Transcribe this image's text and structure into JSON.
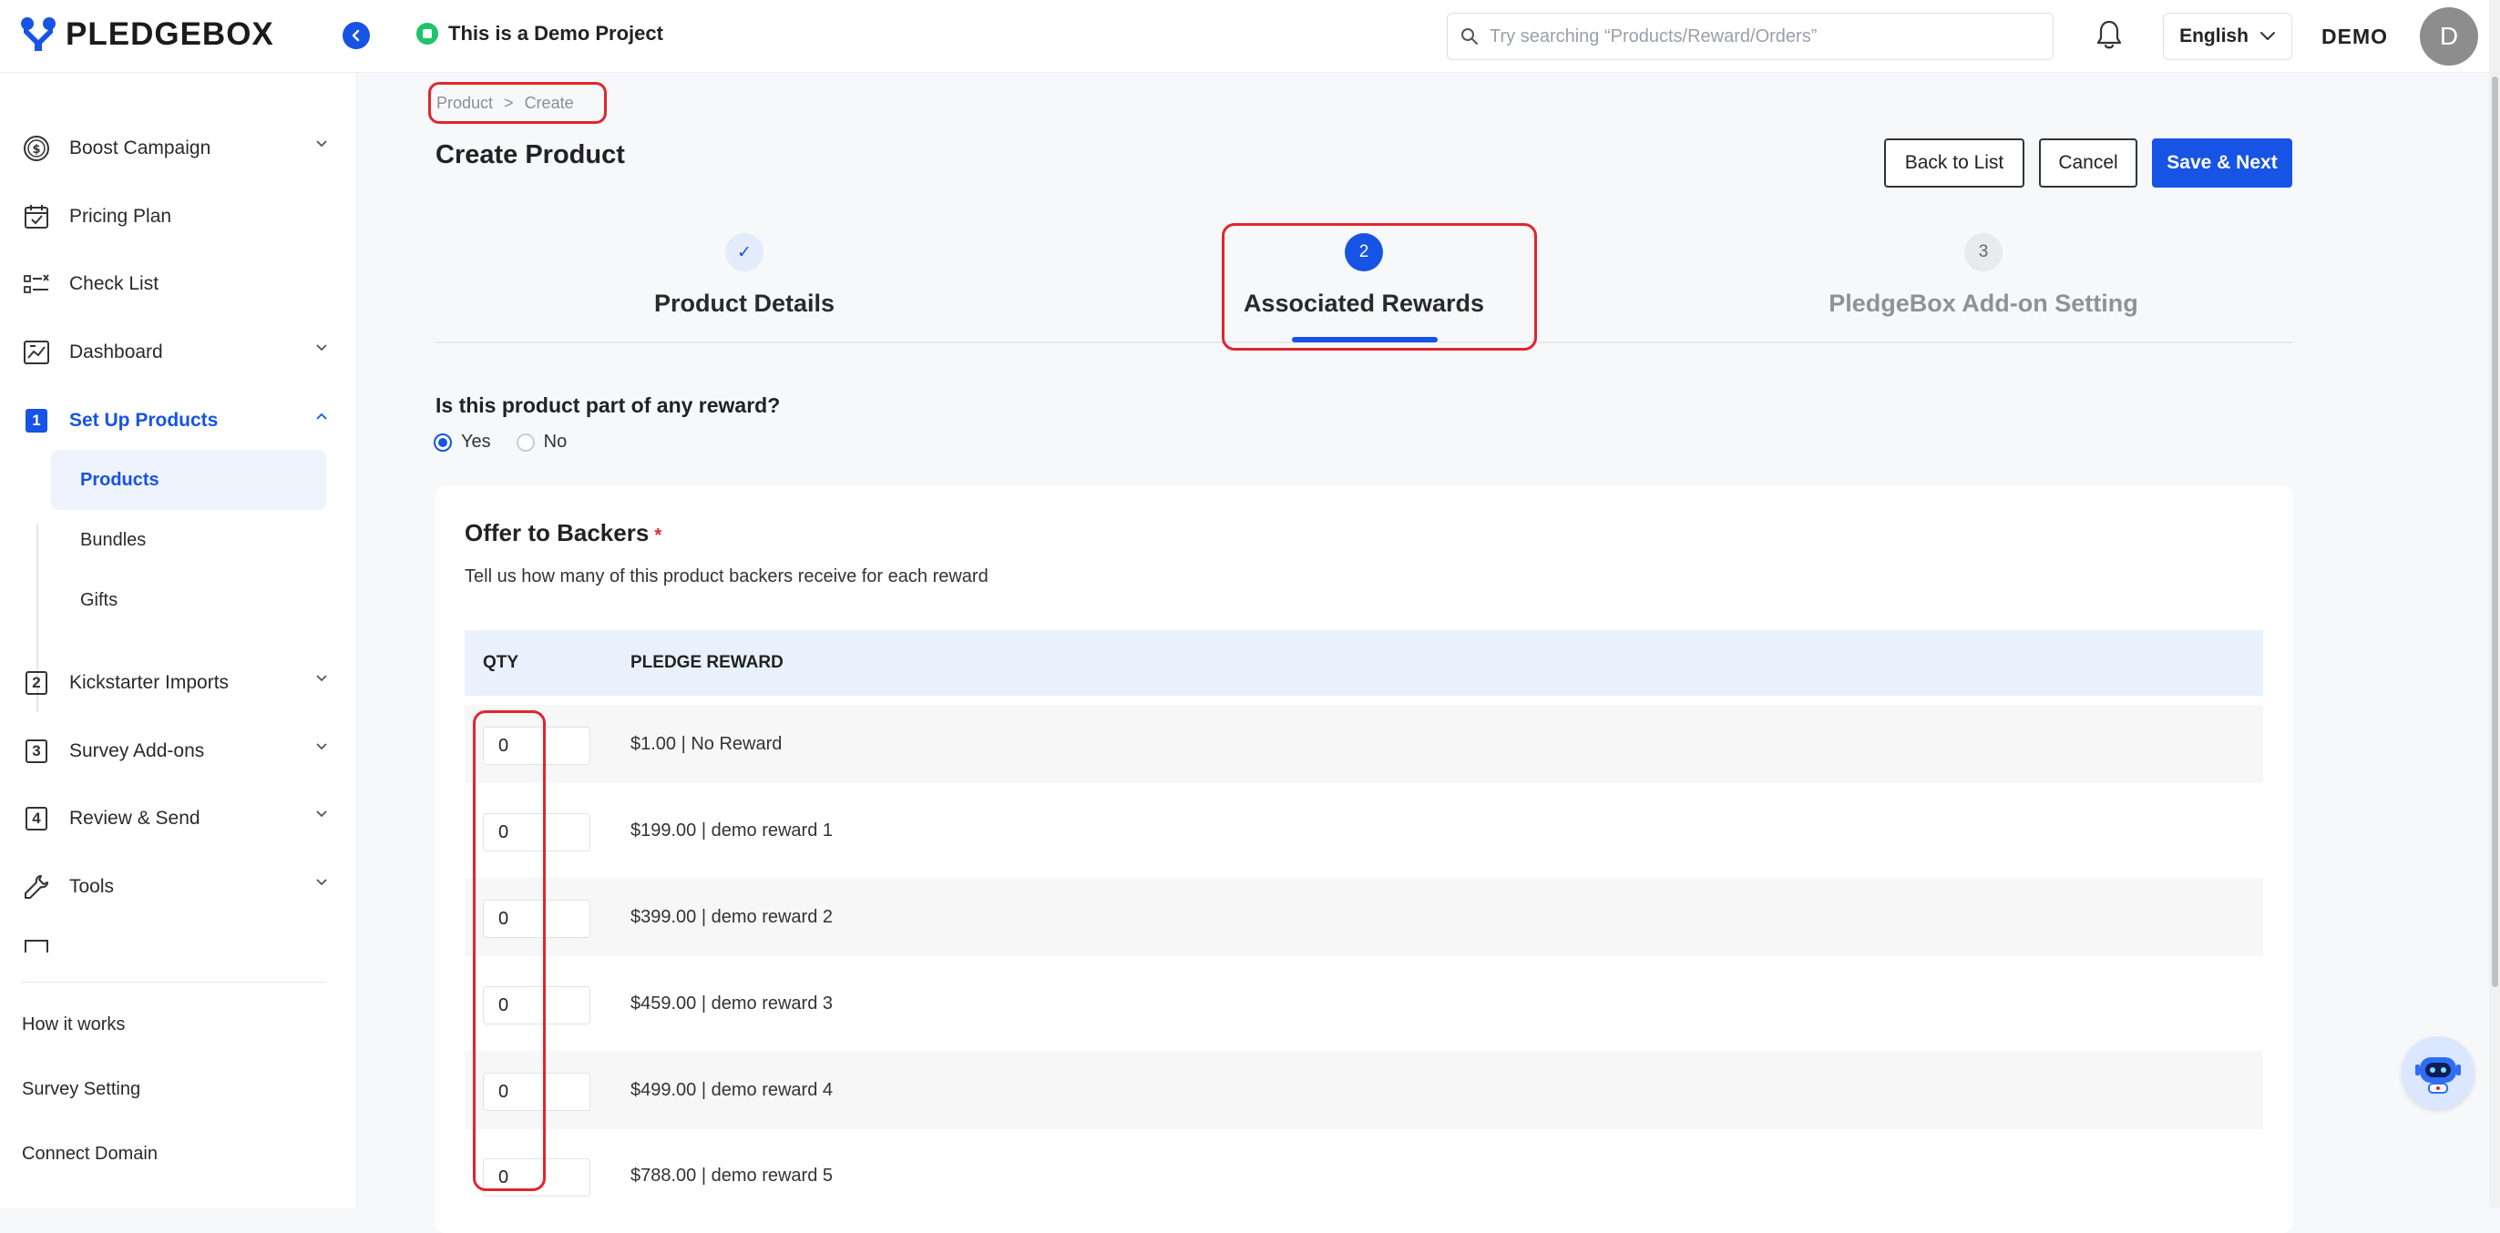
{
  "brand": {
    "name": "PLEDGEBOX",
    "color": "#1753e4"
  },
  "header": {
    "project_label": "This is a Demo Project",
    "search_placeholder": "Try searching “Products/Reward/Orders”",
    "language": "English",
    "user_name": "DEMO",
    "avatar_initial": "D"
  },
  "sidebar": {
    "items": [
      {
        "label": "Boost Campaign",
        "icon": "dollar-coin-icon"
      },
      {
        "label": "Pricing Plan",
        "icon": "calendar-check-icon"
      },
      {
        "label": "Check List",
        "icon": "checklist-icon"
      },
      {
        "label": "Dashboard",
        "icon": "dashboard-chart-icon"
      },
      {
        "label": "Set Up Products",
        "number": "1"
      },
      {
        "label": "Kickstarter Imports",
        "number": "2"
      },
      {
        "label": "Survey Add-ons",
        "number": "3"
      },
      {
        "label": "Review & Send",
        "number": "4"
      },
      {
        "label": "Tools",
        "icon": "wrench-icon"
      }
    ],
    "sub_items": [
      "Products",
      "Bundles",
      "Gifts"
    ],
    "footer_links": [
      "How it works",
      "Survey Setting",
      "Connect Domain"
    ]
  },
  "breadcrumb": {
    "parent": "Product",
    "separator": ">",
    "current": "Create"
  },
  "page": {
    "title": "Create Product",
    "buttons": {
      "back": "Back to List",
      "cancel": "Cancel",
      "save_next": "Save & Next"
    }
  },
  "steps": [
    {
      "number": "✓",
      "label": "Product Details",
      "state": "done"
    },
    {
      "number": "2",
      "label": "Associated Rewards",
      "state": "active"
    },
    {
      "number": "3",
      "label": "PledgeBox Add-on Setting",
      "state": "pending"
    }
  ],
  "question": {
    "text": "Is this product part of any reward?",
    "options": [
      "Yes",
      "No"
    ],
    "selected": "Yes"
  },
  "offer": {
    "title": "Offer to Backers",
    "required_mark": "*",
    "subtitle": "Tell us how many of this product backers receive for each reward",
    "columns": [
      "QTY",
      "PLEDGE REWARD"
    ],
    "rows": [
      {
        "qty": "0",
        "reward": "$1.00 | No Reward"
      },
      {
        "qty": "0",
        "reward": "$199.00 | demo reward 1"
      },
      {
        "qty": "0",
        "reward": "$399.00 | demo reward 2"
      },
      {
        "qty": "0",
        "reward": "$459.00 | demo reward 3"
      },
      {
        "qty": "0",
        "reward": "$499.00 | demo reward 4"
      },
      {
        "qty": "0",
        "reward": "$788.00 | demo reward 5"
      }
    ]
  }
}
